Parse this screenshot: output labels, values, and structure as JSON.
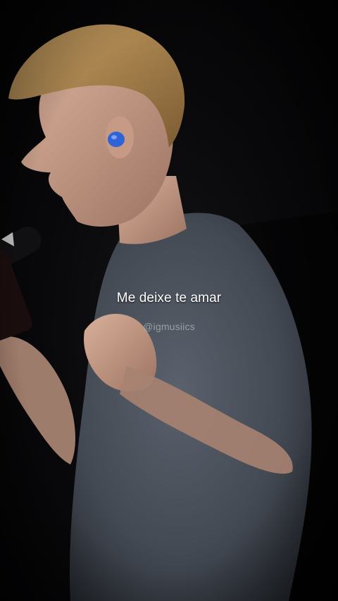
{
  "video": {
    "lyric_text": "Me deixe te amar",
    "watermark_text": "@igmusiics"
  },
  "colors": {
    "background": "#050506",
    "shirt": "#4e5560",
    "skin": "#c9a08a",
    "hair": "#b88d55",
    "earpiece": "#2f63d8"
  }
}
